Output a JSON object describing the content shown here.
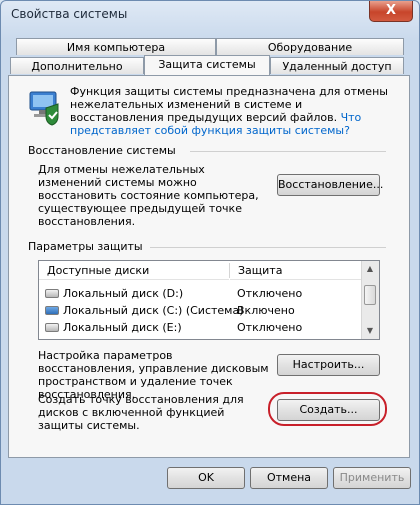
{
  "window": {
    "title": "Свойства системы",
    "close_glyph": "X"
  },
  "tabs": {
    "row1": [
      "Имя компьютера",
      "Оборудование"
    ],
    "row2": [
      "Дополнительно",
      "Защита системы",
      "Удаленный доступ"
    ],
    "active": "Защита системы"
  },
  "intro": {
    "text": "Функция защиты системы предназначена для отмены нежелательных изменений в системе и восстановления предыдущих версий файлов.",
    "link1": "Что представляет собой",
    "link2": "функция защиты системы?"
  },
  "restore": {
    "group_label": "Восстановление системы",
    "description": "Для отмены нежелательных изменений системы можно восстановить состояние компьютера, существующее предыдущей точке восстановления.",
    "button": "Восстановление..."
  },
  "protection": {
    "group_label": "Параметры защиты",
    "columns": [
      "Доступные диски",
      "Защита"
    ],
    "drives": [
      {
        "name": "Локальный диск (D:)",
        "status": "Отключено",
        "system": false
      },
      {
        "name": "Локальный диск (C:) (Система)",
        "status": "Включено",
        "system": true
      },
      {
        "name": "Локальный диск (E:)",
        "status": "Отключено",
        "system": false
      }
    ]
  },
  "configure": {
    "description": "Настройка параметров восстановления, управление дисковым пространством и удаление точек восстановления.",
    "button": "Настроить..."
  },
  "create": {
    "description": "Создать точку восстановления для дисков с включенной функцией защиты системы.",
    "button": "Создать..."
  },
  "dialog_buttons": {
    "ok": "OK",
    "cancel": "Отмена",
    "apply": "Применить"
  },
  "colors": {
    "accent_link": "#0066cc",
    "highlight_ring": "#c8202a"
  }
}
